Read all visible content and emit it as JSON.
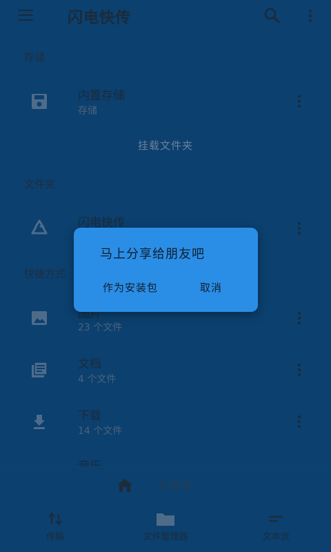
{
  "app": {
    "title": "闪电快传"
  },
  "sections": {
    "storage": {
      "header": "存储",
      "item": {
        "name": "内置存储",
        "sub": "存储"
      },
      "mount_link": "挂载文件夹"
    },
    "folders": {
      "header": "文件夹",
      "item": {
        "name": "闪电快传",
        "sub": ""
      }
    },
    "shortcuts": {
      "header": "快捷方式",
      "items": [
        {
          "name": "图片",
          "sub": "23 个文件",
          "icon": "image-icon"
        },
        {
          "name": "文档",
          "sub": "4 个文件",
          "icon": "document-icon"
        },
        {
          "name": "下载",
          "sub": "14 个文件",
          "icon": "download-icon"
        },
        {
          "name": "音乐",
          "sub": "",
          "icon": "music-icon"
        }
      ]
    }
  },
  "bottom": {
    "home_label": "主目录",
    "tabs": [
      {
        "label": "传输",
        "icon": "transfer-icon"
      },
      {
        "label": "文件管理器",
        "icon": "folder-icon"
      },
      {
        "label": "文本流",
        "icon": "text-stream-icon"
      }
    ]
  },
  "dialog": {
    "message": "马上分享给朋友吧",
    "apk_button": "作为安装包",
    "cancel_button": "取消"
  },
  "colors": {
    "background": "#0b406f",
    "dialog": "#2b8ee6",
    "text_dark": "#1b2b3a"
  }
}
